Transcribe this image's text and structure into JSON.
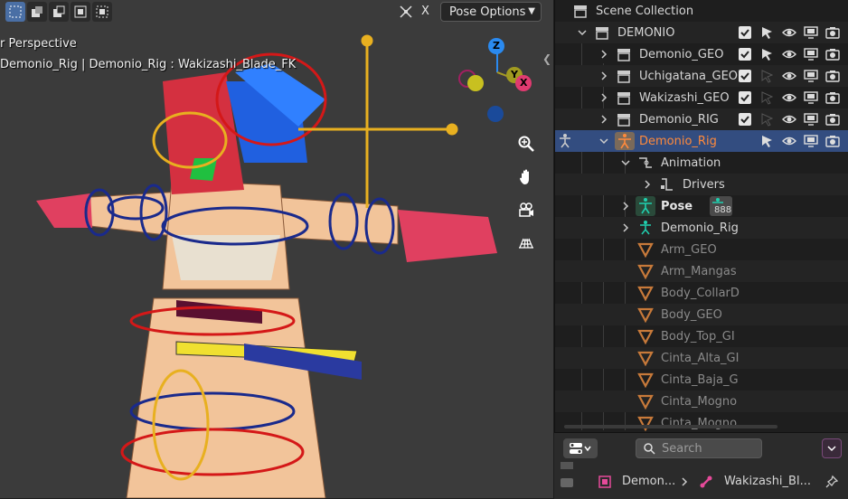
{
  "viewport": {
    "view_name": "r Perspective",
    "active_info": "Demonio_Rig | Demonio_Rig : Wakizashi_Blade_FK",
    "mirror_label": "X",
    "pose_options_label": "Pose Options",
    "axes": {
      "z": "Z",
      "x": "X",
      "y": "Y"
    }
  },
  "outliner": {
    "rows": [
      {
        "label": "Scene Collection",
        "icon": "scene-collection-icon",
        "dim": false
      },
      {
        "label": "DEMONIO",
        "icon": "collection-icon",
        "dim": false
      },
      {
        "label": "Demonio_GEO",
        "icon": "collection-icon",
        "dim": false
      },
      {
        "label": "Uchigatana_GEO",
        "icon": "collection-icon",
        "dim": false
      },
      {
        "label": "Wakizashi_GEO",
        "icon": "collection-icon",
        "dim": false
      },
      {
        "label": "Demonio_RIG",
        "icon": "collection-icon",
        "dim": false
      },
      {
        "label": "Demonio_Rig",
        "icon": "armature-object-icon",
        "dim": false
      },
      {
        "label": "Animation",
        "icon": "animation-icon",
        "dim": false
      },
      {
        "label": "Drivers",
        "icon": "drivers-icon",
        "dim": false
      },
      {
        "label": "Pose",
        "icon": "pose-icon",
        "badge": "888",
        "dim": false
      },
      {
        "label": "Demonio_Rig",
        "icon": "armature-data-icon",
        "dim": false
      },
      {
        "label": "Arm_GEO",
        "icon": "modifier-icon",
        "dim": true
      },
      {
        "label": "Arm_Mangas",
        "icon": "modifier-icon",
        "dim": true
      },
      {
        "label": "Body_CollarD",
        "icon": "modifier-icon",
        "dim": true
      },
      {
        "label": "Body_GEO",
        "icon": "modifier-icon",
        "dim": true
      },
      {
        "label": "Body_Top_GI",
        "icon": "modifier-icon",
        "dim": true
      },
      {
        "label": "Cinta_Alta_GI",
        "icon": "modifier-icon",
        "dim": true
      },
      {
        "label": "Cinta_Baja_G",
        "icon": "modifier-icon",
        "dim": true
      },
      {
        "label": "Cinta_Mogno",
        "icon": "modifier-icon",
        "dim": true
      },
      {
        "label": "Cinta_Mogno",
        "icon": "modifier-icon",
        "dim": true
      }
    ]
  },
  "footer": {
    "search_placeholder": "Search",
    "breadcrumb_object": "Demon...",
    "breadcrumb_bone": "Wakizashi_Bl..."
  },
  "colors": {
    "selection": "#334d80",
    "active_label": "#ff8a3c",
    "bone_blue": "#1a2a8c",
    "bone_red": "#d41818",
    "bone_yellow": "#e8b020"
  }
}
